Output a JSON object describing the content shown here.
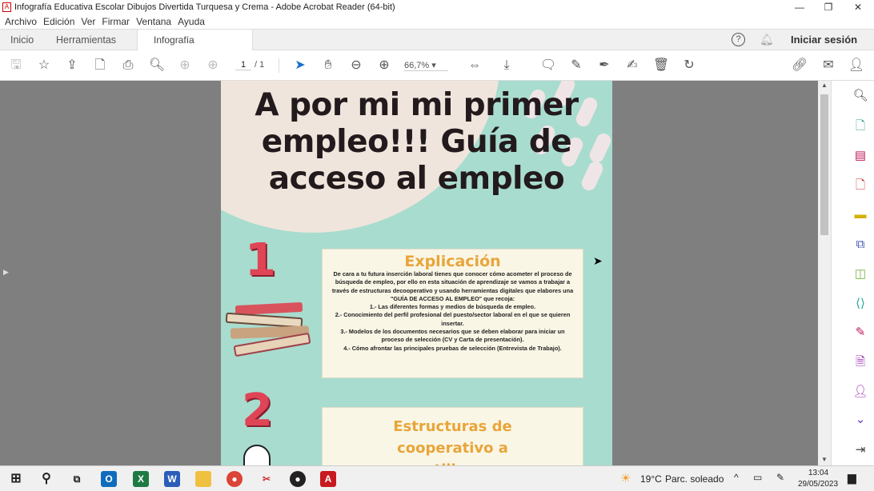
{
  "window": {
    "title": "Infografía Educativa Escolar Dibujos Divertida Turquesa y Crema - Adobe Acrobat Reader (64-bit)",
    "minimize": "—",
    "restore": "❐",
    "close": "✕"
  },
  "menu": [
    "Archivo",
    "Edición",
    "Ver",
    "Firmar",
    "Ventana",
    "Ayuda"
  ],
  "tabs": {
    "home": "Inicio",
    "tools": "Herramientas",
    "document": "Infografía Educativa...",
    "close": "×",
    "help": "?",
    "signin": "Iniciar sesión"
  },
  "toolbar": {
    "page_current": "1",
    "page_total": "/ 1",
    "zoom": "66,7%"
  },
  "document": {
    "title": "A por mi mi primer empleo!!! Guía de acceso al empleo",
    "step1": "1",
    "step2": "2",
    "card1": {
      "heading": "Explicación",
      "lines": [
        "De cara a tu futura inserción laboral tienes  que conocer cómo acometer el proceso de búsqueda de empleo, por ello en esta situación de aprendizaje se vamos a  trabajar a través de estructuras  decooperativo y usando herramientas digitales que elabores una \"GUÍA DE ACCESO AL EMPLEO\" que recoja:",
        "1.- Las diferentes formas  y medios de búsqueda de empleo.",
        "2.- Conocimiento del perfil profesional del puesto/sector laboral en el que se quieren insertar.",
        "3.-  Modelos de los documentos necesarios que se deben  elaborar para iniciar un proceso de selección (CV y Carta de presentación).",
        "4.- Cómo afrontar las principales pruebas de selección (Entrevista de Trabajo)."
      ]
    },
    "card2": {
      "heading": "Estructuras de cooperativo a utilizar"
    }
  },
  "taskbar": {
    "weather_temp": "19°C",
    "weather_text": "Parc. soleado",
    "time": "13:04",
    "date": "29/05/2023"
  },
  "colors": {
    "page_bg": "#a8dccf",
    "accent": "#e8a53a",
    "number": "#e04457"
  }
}
